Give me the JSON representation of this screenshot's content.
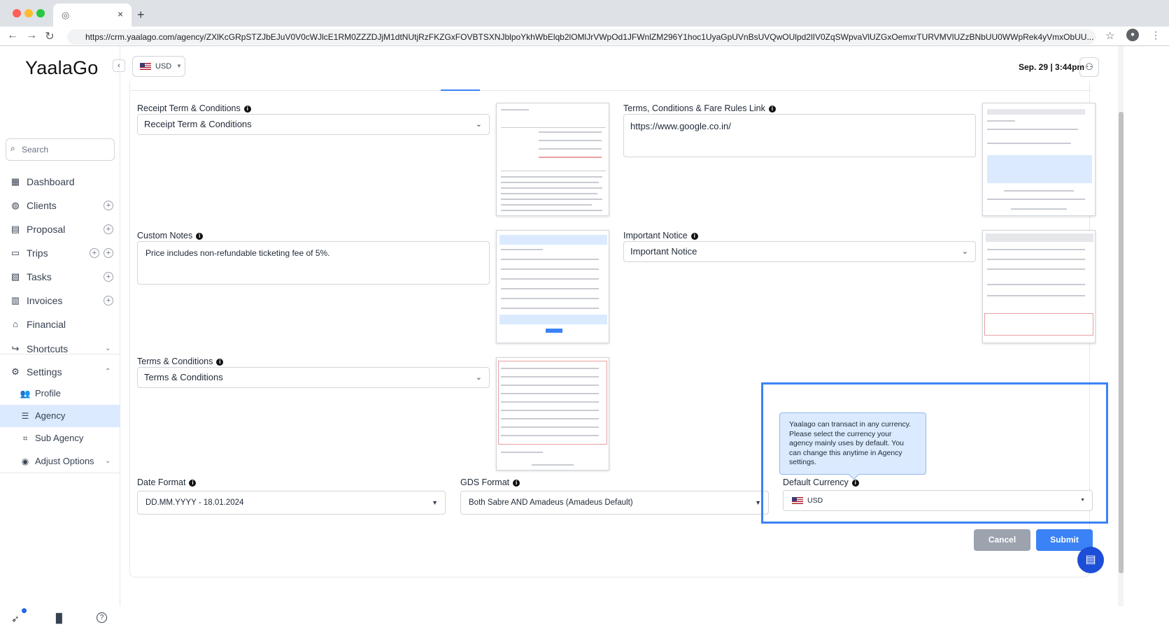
{
  "browser": {
    "url": "https://crm.yaalago.com/agency/ZXlKcGRpSTZJbEJuV0V0cWJlcE1RM0ZZZDJjM1dtNUtjRzFKZGxFOVBTSXNJblpoYkhWbElqb2lOMlJrVWpOd1JFWnlZM296Y1hoc1UyaGpUVnBsUVQwOUlpd2lIV0ZqSWpvaVlUZGxOemxrTURVMVlUZzBNbUU0WWpRek4yVmxObUU..."
  },
  "app": {
    "logo": "YaalaGo",
    "currency_button": "USD",
    "datetime": "Sep. 29 | 3:44pm"
  },
  "sidebar": {
    "search_placeholder": "Search",
    "items": [
      {
        "label": "Dashboard",
        "icon": "grid-icon"
      },
      {
        "label": "Clients",
        "icon": "globe-icon"
      },
      {
        "label": "Proposal",
        "icon": "document-icon"
      },
      {
        "label": "Trips",
        "icon": "ticket-icon"
      },
      {
        "label": "Tasks",
        "icon": "clipboard-icon"
      },
      {
        "label": "Invoices",
        "icon": "invoice-icon"
      },
      {
        "label": "Financial",
        "icon": "bank-icon"
      },
      {
        "label": "Shortcuts",
        "icon": "share-icon"
      },
      {
        "label": "Settings",
        "icon": "gear-icon"
      }
    ],
    "sub_items": [
      {
        "label": "Profile",
        "icon": "users-icon"
      },
      {
        "label": "Agency",
        "icon": "server-icon"
      },
      {
        "label": "Sub Agency",
        "icon": "hierarchy-icon"
      },
      {
        "label": "Adjust Options",
        "icon": "toggle-icon"
      }
    ]
  },
  "form": {
    "receipt_terms": {
      "label": "Receipt Term & Conditions",
      "value": "Receipt Term & Conditions"
    },
    "fare_rules_link": {
      "label": "Terms, Conditions & Fare Rules Link",
      "value": "https://www.google.co.in/"
    },
    "custom_notes": {
      "label": "Custom Notes",
      "value": "Price includes non-refundable ticketing fee of 5%."
    },
    "important_notice": {
      "label": "Important Notice",
      "value": "Important Notice"
    },
    "terms_conditions": {
      "label": "Terms & Conditions",
      "value": "Terms & Conditions"
    },
    "date_format": {
      "label": "Date Format",
      "value": "DD.MM.YYYY - 18.01.2024"
    },
    "gds_format": {
      "label": "GDS Format",
      "value": "Both Sabre AND Amadeus (Amadeus Default)"
    },
    "default_currency": {
      "label": "Default Currency",
      "value": "USD"
    },
    "tooltip": "Yaalago can transact in any currency. Please select the currency your agency mainly uses by default. You can change this anytime in Agency settings.",
    "cancel_label": "Cancel",
    "submit_label": "Submit"
  },
  "colors": {
    "accent": "#3b82f6",
    "submit": "#3b82f6",
    "cancel": "#9ca3af",
    "active_nav_bg": "#dbeafe"
  }
}
